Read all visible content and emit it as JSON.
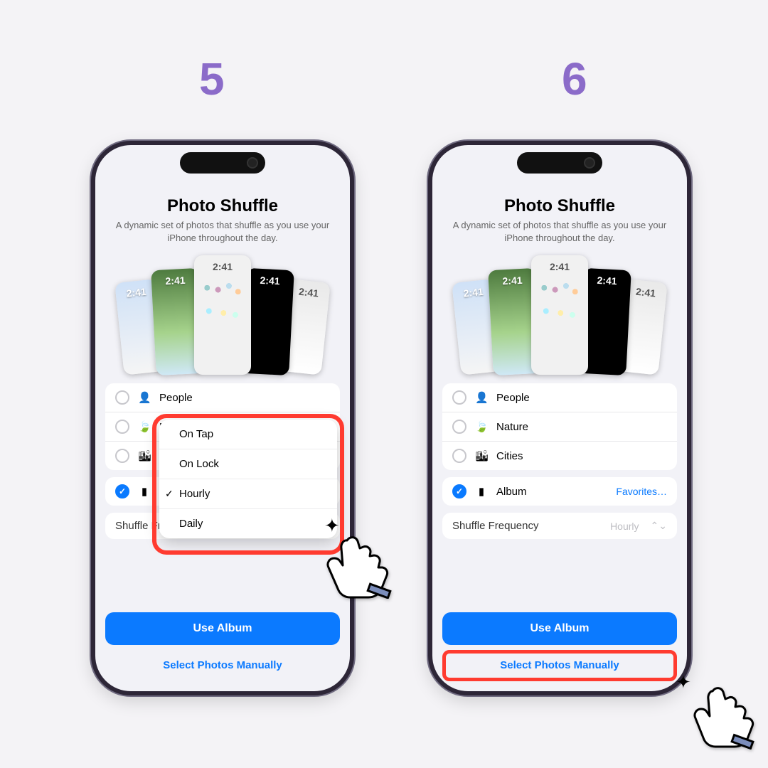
{
  "steps": {
    "left": "5",
    "right": "6"
  },
  "screen": {
    "title": "Photo Shuffle",
    "subtitle": "A dynamic set of photos that shuffle as you use your iPhone throughout the day.",
    "preview_time": "2:41"
  },
  "categories": {
    "people": "People",
    "nature": "Nature",
    "cities": "Cities",
    "album": "Album",
    "album_value": "Favorites…"
  },
  "frequency": {
    "label": "Shuffle Frequency",
    "value": "Hourly"
  },
  "popup": {
    "ontap": "On Tap",
    "onlock": "On Lock",
    "hourly": "Hourly",
    "daily": "Daily"
  },
  "buttons": {
    "primary": "Use Album",
    "link": "Select Photos Manually"
  },
  "icons": {
    "person": "👤",
    "leaf": "🍃",
    "city": "🏙",
    "album": "▮",
    "updown": "⌃⌄",
    "check": "✓"
  }
}
